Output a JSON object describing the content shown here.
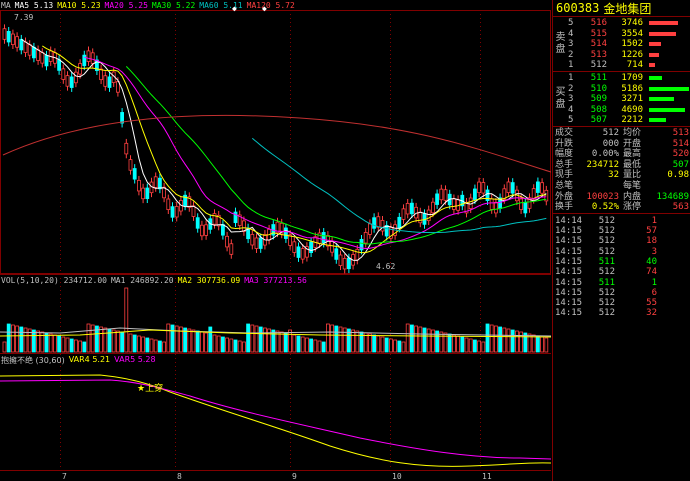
{
  "stock": {
    "code": "600383",
    "name": "金地集团"
  },
  "price_chart": {
    "ma_legend": [
      {
        "label": "MA",
        "text": "",
        "color": "#c0c0c0"
      },
      {
        "label": "MA5",
        "text": "5.13",
        "color": "#ffffff"
      },
      {
        "label": "MA10",
        "text": "5.23",
        "color": "#ffff00"
      },
      {
        "label": "MA20",
        "text": "5.25",
        "color": "#ff00ff"
      },
      {
        "label": "MA30",
        "text": "5.22",
        "color": "#00ff00"
      },
      {
        "label": "MA60",
        "text": "5.11",
        "color": "#00c0c0"
      },
      {
        "label": "MA120",
        "text": "5.72",
        "color": "#ff4040"
      }
    ],
    "high_label": "7.39",
    "low_label": "4.62",
    "markers": [
      "◆",
      "◆"
    ],
    "x_ticks": [
      "7",
      "8",
      "9",
      "10",
      "11"
    ]
  },
  "volume_chart": {
    "legend": [
      {
        "label": "VOL(5,10,20)",
        "text": "234712.00",
        "color": "#c0c0c0"
      },
      {
        "label": "MA1",
        "text": "246892.20",
        "color": "#c0c0c0"
      },
      {
        "label": "MA2",
        "text": "307736.09",
        "color": "#ffff00"
      },
      {
        "label": "MA3",
        "text": "377213.56",
        "color": "#ff00ff"
      }
    ]
  },
  "indicator_chart": {
    "legend": [
      {
        "label": "抱擁不绝",
        "text": "(30,60)",
        "color": "#c0c0c0"
      },
      {
        "label": "VAR4",
        "text": "5.21",
        "color": "#ffff00"
      },
      {
        "label": "VAR5",
        "text": "5.28",
        "color": "#ff00ff"
      }
    ],
    "signal": "上穿"
  },
  "order_book": {
    "sell_label": [
      "卖",
      "盘"
    ],
    "buy_label": [
      "买",
      "盘"
    ],
    "sell": [
      {
        "level": "5",
        "price": "516",
        "volume": "3746",
        "color": "#ff4040",
        "bar": 0.72
      },
      {
        "level": "4",
        "price": "515",
        "volume": "3554",
        "color": "#ff4040",
        "bar": 0.68
      },
      {
        "level": "3",
        "price": "514",
        "volume": "1502",
        "color": "#ff4040",
        "bar": 0.29
      },
      {
        "level": "2",
        "price": "513",
        "volume": "1226",
        "color": "#ff4040",
        "bar": 0.24
      },
      {
        "level": "1",
        "price": "512",
        "volume": "714",
        "color": "#c0c0c0",
        "bar": 0.14
      }
    ],
    "buy": [
      {
        "level": "1",
        "price": "511",
        "volume": "1709",
        "color": "#00ff00",
        "bar": 0.33
      },
      {
        "level": "2",
        "price": "510",
        "volume": "5186",
        "color": "#00ff00",
        "bar": 1.0
      },
      {
        "level": "3",
        "price": "509",
        "volume": "3271",
        "color": "#00ff00",
        "bar": 0.63
      },
      {
        "level": "4",
        "price": "508",
        "volume": "4690",
        "color": "#00ff00",
        "bar": 0.9
      },
      {
        "level": "5",
        "price": "507",
        "volume": "2212",
        "color": "#00ff00",
        "bar": 0.43
      }
    ]
  },
  "stats": [
    {
      "l1": "成交",
      "v1": "512",
      "c1": "#c0c0c0",
      "l2": "均价",
      "v2": "513",
      "c2": "#ff4040"
    },
    {
      "l1": "升跌",
      "v1": "000",
      "c1": "#c0c0c0",
      "l2": "开盘",
      "v2": "514",
      "c2": "#ff4040"
    },
    {
      "l1": "幅度",
      "v1": "0.00%",
      "c1": "#c0c0c0",
      "l2": "最高",
      "v2": "520",
      "c2": "#ff4040"
    },
    {
      "l1": "总手",
      "v1": "234712",
      "c1": "#ffff00",
      "l2": "最低",
      "v2": "507",
      "c2": "#00ff00"
    },
    {
      "l1": "现手",
      "v1": "32",
      "c1": "#ffff00",
      "l2": "量比",
      "v2": "0.98",
      "c2": "#ffff00"
    },
    {
      "l1": "总笔",
      "v1": "",
      "c1": "#c0c0c0",
      "l2": "每笔",
      "v2": "",
      "c2": "#c0c0c0"
    },
    {
      "l1": "外盘",
      "v1": "100023",
      "c1": "#ff4040",
      "l2": "内盘",
      "v2": "134689",
      "c2": "#00ff00"
    },
    {
      "l1": "换手",
      "v1": "0.52%",
      "c1": "#ffff00",
      "l2": "涨停",
      "v2": "563",
      "c2": "#ff4040"
    }
  ],
  "ticks": [
    {
      "time": "14:14",
      "price": "512",
      "volume": "1",
      "color": "#ff4040"
    },
    {
      "time": "14:15",
      "price": "512",
      "volume": "57",
      "color": "#ff4040"
    },
    {
      "time": "14:15",
      "price": "512",
      "volume": "18",
      "color": "#ff4040"
    },
    {
      "time": "14:15",
      "price": "512",
      "volume": "3",
      "color": "#ff4040"
    },
    {
      "time": "14:15",
      "price": "511",
      "volume": "40",
      "color": "#00ff00"
    },
    {
      "time": "14:15",
      "price": "512",
      "volume": "74",
      "color": "#ff4040"
    },
    {
      "time": "14:15",
      "price": "511",
      "volume": "1",
      "color": "#00ff00"
    },
    {
      "time": "14:15",
      "price": "512",
      "volume": "6",
      "color": "#ff4040"
    },
    {
      "time": "14:15",
      "price": "512",
      "volume": "55",
      "color": "#ff4040"
    },
    {
      "time": "14:15",
      "price": "512",
      "volume": "32",
      "color": "#ff4040"
    }
  ],
  "colors": {
    "up": "#ff4040",
    "down": "#00ffff",
    "frame": "#800000",
    "bg": "#000000"
  }
}
